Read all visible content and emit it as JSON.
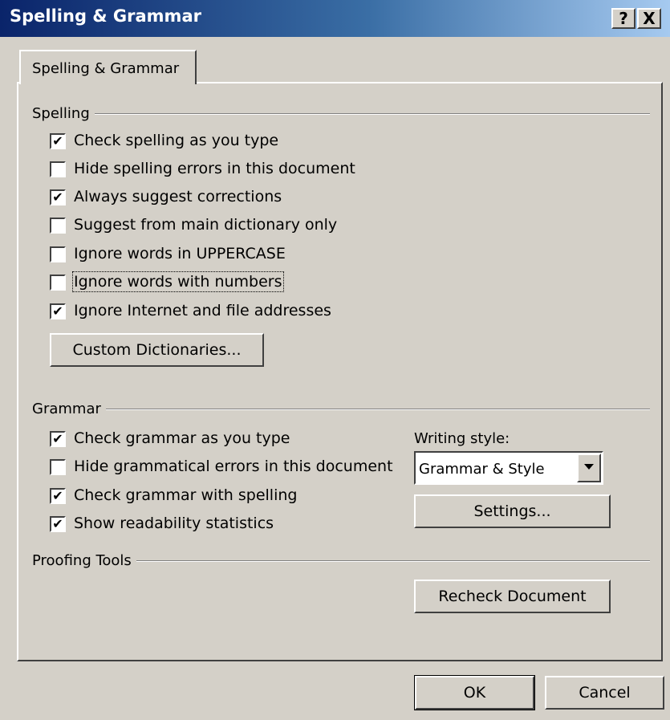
{
  "window": {
    "title": "Spelling & Grammar",
    "help_label": "?",
    "close_label": "X"
  },
  "tab": {
    "label": "Spelling & Grammar"
  },
  "spelling": {
    "heading": "Spelling",
    "options": [
      {
        "label": "Check spelling as you type",
        "checked": true
      },
      {
        "label": "Hide spelling errors in this document",
        "checked": false
      },
      {
        "label": "Always suggest corrections",
        "checked": true
      },
      {
        "label": "Suggest from main dictionary only",
        "checked": false
      },
      {
        "label": "Ignore words in UPPERCASE",
        "checked": false
      },
      {
        "label": "Ignore words with numbers",
        "checked": false
      },
      {
        "label": "Ignore Internet and file addresses",
        "checked": true
      }
    ],
    "custom_dictionaries_label": "Custom Dictionaries..."
  },
  "grammar": {
    "heading": "Grammar",
    "options": [
      {
        "label": "Check grammar as you type",
        "checked": true
      },
      {
        "label": "Hide grammatical errors in this document",
        "checked": false
      },
      {
        "label": "Check grammar with spelling",
        "checked": true
      },
      {
        "label": "Show readability statistics",
        "checked": true
      }
    ],
    "writing_style_label": "Writing style:",
    "writing_style_value": "Grammar & Style",
    "settings_label": "Settings..."
  },
  "proofing": {
    "heading": "Proofing Tools",
    "recheck_label": "Recheck Document"
  },
  "footer": {
    "ok_label": "OK",
    "cancel_label": "Cancel"
  }
}
